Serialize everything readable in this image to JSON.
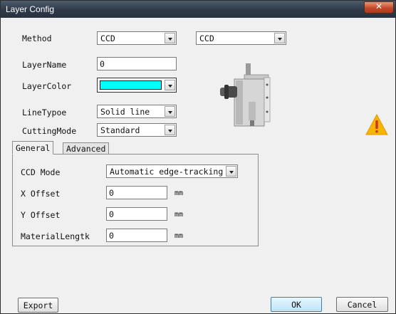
{
  "window": {
    "title": "Layer Config"
  },
  "method": {
    "label": "Method",
    "value1": "CCD",
    "value2": "CCD"
  },
  "layer_name": {
    "label": "LayerName",
    "value": "0"
  },
  "layer_color": {
    "label": "LayerColor",
    "color": "#00ffff"
  },
  "line_type": {
    "label": "LineTypoe",
    "value": "Solid line"
  },
  "cutting_mode": {
    "label": "CuttingMode",
    "value": "Standard"
  },
  "tabs": [
    {
      "label": "General"
    },
    {
      "label": "Advanced"
    }
  ],
  "general": {
    "ccd_mode": {
      "label": "CCD Mode",
      "value": "Automatic edge-tracking"
    },
    "x_offset": {
      "label": "X Offset",
      "value": "0",
      "unit": "mm"
    },
    "y_offset": {
      "label": "Y Offset",
      "value": "0",
      "unit": "mm"
    },
    "material_length": {
      "label": "MaterialLengtk",
      "value": "0",
      "unit": "mm"
    }
  },
  "buttons": {
    "export": "Export",
    "ok": "OK",
    "cancel": "Cancel"
  },
  "icons": {
    "close": "close-icon",
    "warning": "warning-icon",
    "tool": "cutting-tool-image"
  }
}
